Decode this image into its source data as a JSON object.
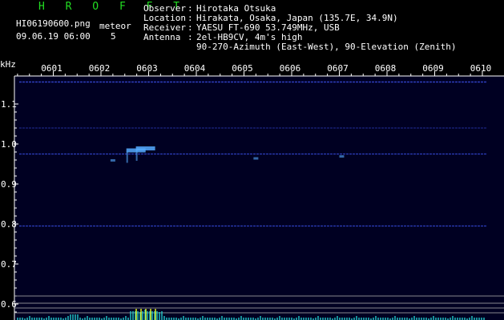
{
  "header": {
    "app_title": "H R O F F T",
    "file_name": "HI06190600.png",
    "datetime": "09.06.19 06:00",
    "mode_label": "meteor",
    "meteor_count": "5",
    "info_labels": [
      "Observer",
      "Location",
      "Receiver",
      "Antenna"
    ],
    "info_values": [
      "Hirotaka Otsuka",
      "Hirakata, Osaka, Japan (135.7E, 34.9N)",
      "YAESU FT-690 53.749MHz, USB",
      "2el-HB9CV, 4m's high"
    ],
    "antenna_line2": "90-270-Azimuth (East-West), 90-Elevation (Zenith)"
  },
  "chart_data": {
    "type": "heatmap",
    "xlabel": "",
    "ylabel": "kHz",
    "x_ticks": [
      "0601",
      "0602",
      "0603",
      "0604",
      "0605",
      "0606",
      "0607",
      "0608",
      "0609",
      "0610"
    ],
    "y_ticks": [
      "1.1",
      "1.0",
      "0.9",
      "0.8",
      "0.7",
      "0.6"
    ],
    "ylim": [
      0.59,
      1.16
    ],
    "xlim": [
      0.0,
      10.0
    ],
    "grid": false,
    "horizontal_carriers_khz": [
      1.155,
      1.04,
      0.975,
      0.795
    ],
    "meteor_echoes": [
      {
        "time_min": 2.6,
        "freq_khz": 0.985,
        "intensity": "strong"
      },
      {
        "time_min": 2.8,
        "freq_khz": 0.99,
        "intensity": "strong"
      },
      {
        "time_min": 2.25,
        "freq_khz": 0.96,
        "intensity": "weak"
      },
      {
        "time_min": 5.25,
        "freq_khz": 0.965,
        "intensity": "weak"
      },
      {
        "time_min": 7.05,
        "freq_khz": 0.97,
        "intensity": "weak"
      }
    ],
    "colors": {
      "background": "#000000",
      "plot_bg": "#000022",
      "carrier": "#3344cc",
      "echo": "#55aaff",
      "axis": "#ffffff",
      "bottom_lines": "#aaaaaa",
      "spectrum": "#22cccc",
      "spectrum_peak": "#eeff22"
    }
  }
}
